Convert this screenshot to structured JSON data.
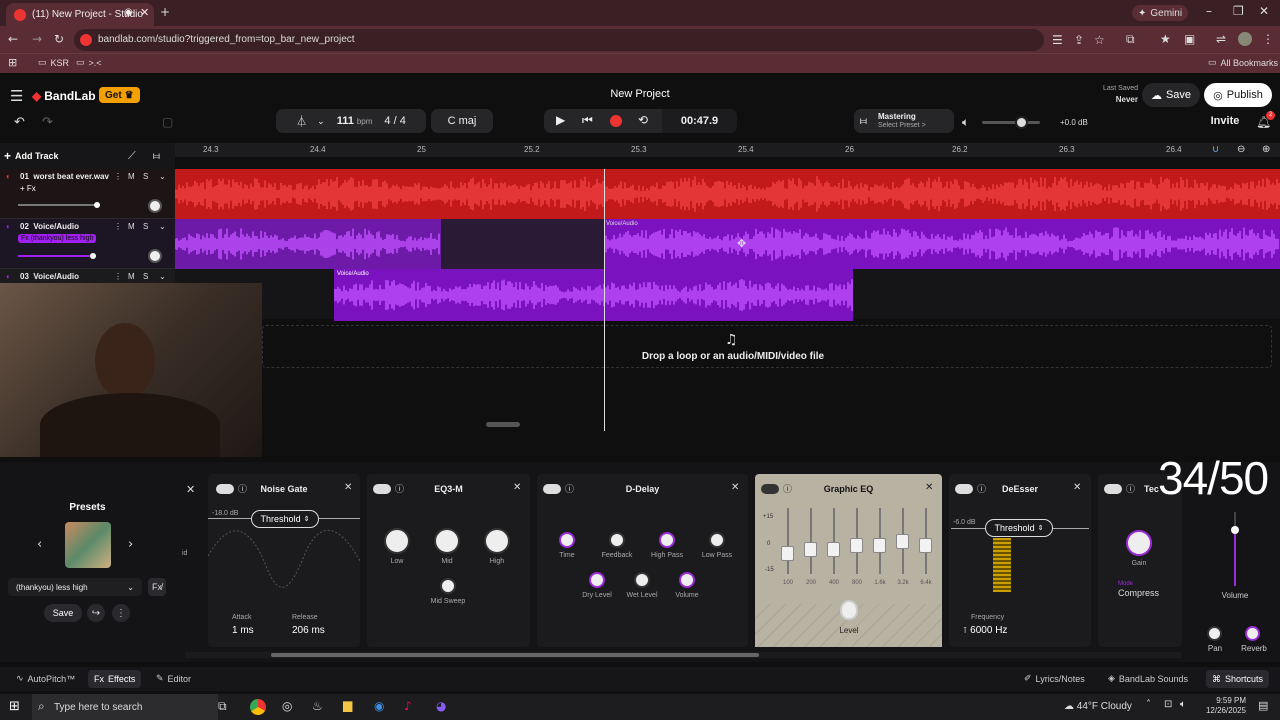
{
  "browser": {
    "tab_title": "(11) New Project - Studio",
    "url": "bandlab.com/studio?triggered_from=top_bar_new_project",
    "gemini_label": "Gemini",
    "bookmarks": [
      "KSR",
      ">.<"
    ],
    "all_bookmarks": "All Bookmarks"
  },
  "app": {
    "brand": "BandLab",
    "get_label": "Get",
    "project_title": "New Project",
    "last_saved_label": "Last Saved",
    "last_saved_value": "Never",
    "save_label": "Save",
    "publish_label": "Publish",
    "invite_label": "Invite",
    "notification_count": "2"
  },
  "transport": {
    "bpm": "111",
    "bpm_unit": "bpm",
    "time_sig": "4 / 4",
    "key": "C maj",
    "time": "00:47.9",
    "mastering_label": "Mastering",
    "mastering_sub": "Select Preset >",
    "master_gain": "+0.0 dB"
  },
  "timeline": {
    "add_track": "Add Track",
    "ruler": [
      "24.3",
      "24.4",
      "25",
      "25.2",
      "25.3",
      "25.4",
      "26",
      "26.2",
      "26.3",
      "26.4"
    ],
    "drop_text": "Drop a loop or an audio/MIDI/video file"
  },
  "tracks": [
    {
      "num": "01",
      "name": "worst beat ever.wav",
      "fx": "+ Fx",
      "m": "M",
      "s": "S"
    },
    {
      "num": "02",
      "name": "Voice/Audio",
      "fx": "Fx (thankyou) less high",
      "m": "M",
      "s": "S"
    },
    {
      "num": "03",
      "name": "Voice/Audio",
      "m": "M",
      "s": "S"
    }
  ],
  "clips": {
    "clip_label": "Voice/Audio"
  },
  "presets": {
    "title": "Presets",
    "selected": "(thankyou) less high",
    "save_label": "Save"
  },
  "effects": {
    "noise_gate": {
      "title": "Noise Gate",
      "db": "-18.0 dB",
      "mode": "Threshold",
      "attack_label": "Attack",
      "attack": "1 ms",
      "release_label": "Release",
      "release": "206 ms"
    },
    "eq3": {
      "title": "EQ3-M",
      "low": "Low",
      "mid": "Mid",
      "high": "High",
      "sweep": "Mid Sweep"
    },
    "delay": {
      "title": "D-Delay",
      "time": "Time",
      "feedback": "Feedback",
      "highpass": "High Pass",
      "lowpass": "Low Pass",
      "dry": "Dry Level",
      "wet": "Wet Level",
      "volume": "Volume"
    },
    "geq": {
      "title": "Graphic EQ",
      "scale": [
        "+15",
        "0",
        "-15"
      ],
      "bands": [
        "100",
        "200",
        "400",
        "800",
        "1.6k",
        "3.2k",
        "6.4k"
      ],
      "level": "Level"
    },
    "deesser": {
      "title": "DeEsser",
      "db": "-6.0 dB",
      "mode": "Threshold",
      "freq_label": "Frequency",
      "freq": "6000 Hz"
    },
    "next": {
      "title": "Tec",
      "gain": "Gain",
      "mode_label": "Mode",
      "mode": "Compress"
    }
  },
  "overlay_counter": "34/50",
  "right_strip": {
    "volume": "Volume",
    "pan": "Pan",
    "reverb": "Reverb"
  },
  "bottom": {
    "autopitch": "AutoPitch™",
    "effects": "Effects",
    "editor": "Editor",
    "lyrics": "Lyrics/Notes",
    "sounds": "BandLab Sounds",
    "shortcuts": "Shortcuts"
  },
  "taskbar": {
    "search": "Type here to search",
    "weather": "44°F  Cloudy",
    "time": "9:59 PM",
    "date": "12/26/2025"
  },
  "colors": {
    "accent": "#9b2bd6",
    "red": "#e31b1b",
    "purple": "#a020f0",
    "get": "#f4a100"
  }
}
